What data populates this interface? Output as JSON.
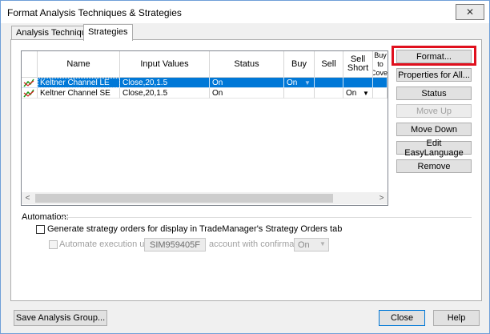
{
  "window": {
    "title": "Format Analysis Techniques & Strategies",
    "close_glyph": "✕"
  },
  "tabs": [
    {
      "label": "Analysis Techniques"
    },
    {
      "label": "Strategies"
    }
  ],
  "grid": {
    "columns": [
      "Name",
      "Input Values",
      "Status",
      "Buy",
      "Sell",
      "Sell Short",
      "Buy to Cover"
    ],
    "rows": [
      {
        "name": "Keltner Channel LE",
        "inputs": "Close,20,1.5",
        "status": "On",
        "buy": "On",
        "sell": "",
        "sell_short": "",
        "buy_to_cover": ""
      },
      {
        "name": "Keltner Channel SE",
        "inputs": "Close,20,1.5",
        "status": "On",
        "buy": "",
        "sell": "",
        "sell_short": "On",
        "buy_to_cover": ""
      }
    ],
    "scroll_left": "<",
    "scroll_right": ">"
  },
  "buttons": {
    "format": "Format...",
    "properties_all": "Properties for All...",
    "status": "Status",
    "move_up": "Move Up",
    "move_down": "Move Down",
    "edit_easylanguage": "Edit EasyLanguage",
    "remove": "Remove",
    "save_group": "Save Analysis Group...",
    "close": "Close",
    "help": "Help"
  },
  "automation": {
    "section_label": "Automation:",
    "generate_label": "Generate strategy orders for display in TradeManager's Strategy Orders tab",
    "auto_exec_label": "Automate execution using",
    "account_value": "SIM959405F",
    "account_suffix": "account with confirmation",
    "confirm_value": "On"
  },
  "colors": {
    "selection": "#0078d7",
    "highlight_box": "#e0101e",
    "icon_green": "#1a9a1a",
    "icon_red": "#d42020"
  }
}
